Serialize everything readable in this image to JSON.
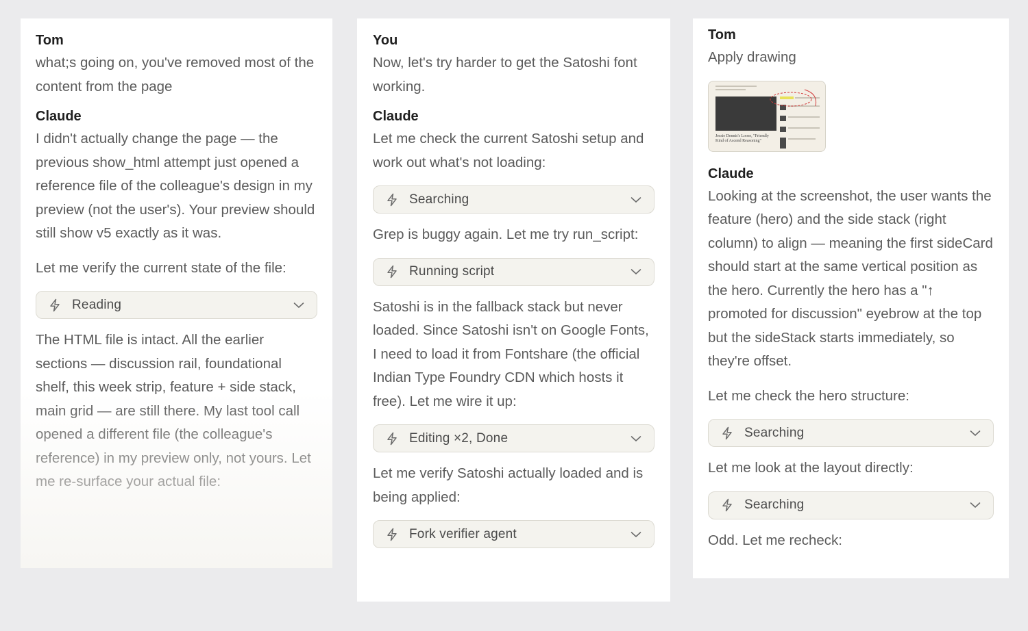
{
  "colors": {
    "background": "#ebebed",
    "panel": "#ffffff",
    "tool_bg": "#f4f3ee",
    "tool_border": "#dcdad2",
    "annotation": "#d23a3a"
  },
  "icons": {
    "tool": "bolt-icon",
    "expand": "chevron-down-icon"
  },
  "panel1": {
    "m1_speaker": "Tom",
    "m1_text": "what;s going on, you've removed most of the content from the page",
    "m2_speaker": "Claude",
    "m2_p1": "I didn't actually change the page — the previous show_html attempt just opened a reference file of the colleague's design in my preview (not the user's). Your preview should still show v5 exactly as it was.",
    "m2_p2": "Let me verify the current state of the file:",
    "tool1": "Reading",
    "m2_p3": "The HTML file is intact. All the earlier sections — discussion rail, foundational shelf, this week strip, feature + side stack, main grid — are still there. My last tool call opened a different file (the colleague's reference) in my preview only, not yours. Let me re-surface your actual file:"
  },
  "panel2": {
    "m1_speaker": "You",
    "m1_text": "Now, let's try harder to get the Satoshi font working.",
    "m2_speaker": "Claude",
    "m2_p1": "Let me check the current Satoshi setup and work out what's not loading:",
    "tool1": "Searching",
    "m2_p2": "Grep is buggy again. Let me try run_script:",
    "tool2": "Running script",
    "m2_p3": "Satoshi is in the fallback stack but never loaded. Since Satoshi isn't on Google Fonts, I need to load it from Fontshare (the official Indian Type Foundry CDN which hosts it free). Let me wire it up:",
    "tool3": "Editing ×2, Done",
    "m2_p4": "Let me verify Satoshi actually loaded and is being applied:",
    "tool4": "Fork verifier agent"
  },
  "panel3": {
    "m1_speaker": "Tom",
    "m1_text": "Apply drawing",
    "attachment_text": "Jessie Dennis's Loose, \"Friendly Kind of Ascend Reasoning\"",
    "m2_speaker": "Claude",
    "m2_p1": "Looking at the screenshot, the user wants the feature (hero) and the side stack (right column) to align — meaning the first sideCard should start at the same vertical position as the hero. Currently the hero has a \"↑ promoted for discussion\" eyebrow at the top but the sideStack starts immediately, so they're offset.",
    "m2_p2": "Let me check the hero structure:",
    "tool1": "Searching",
    "m2_p3": "Let me look at the layout directly:",
    "tool2": "Searching",
    "m2_p4": "Odd. Let me recheck:"
  }
}
